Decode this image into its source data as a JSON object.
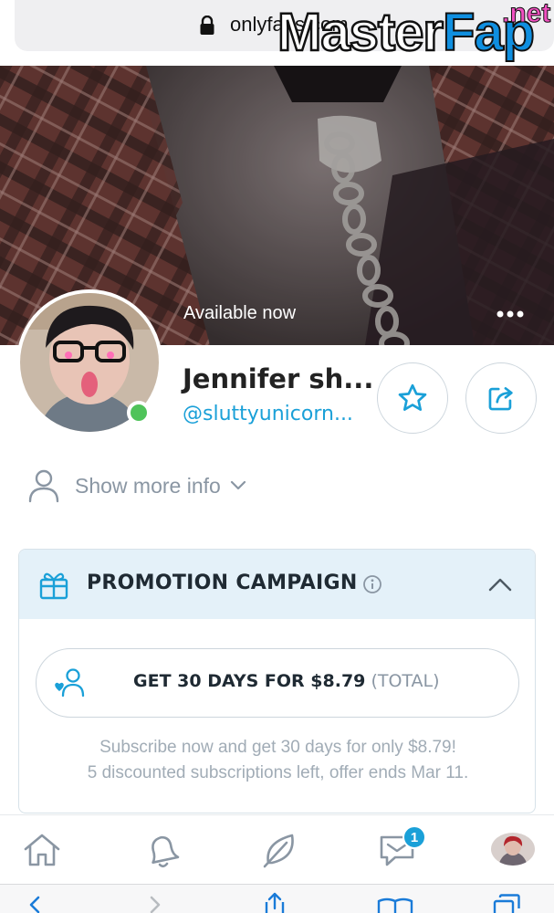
{
  "browser": {
    "url": "onlyfans.com"
  },
  "watermark": {
    "brand_main": "Master",
    "brand_accent": "Fap",
    "brand_tld": ".net"
  },
  "profile": {
    "status": "Available now",
    "name": "Jennifer sh...",
    "handle": "@sluttyunicorn...",
    "online": true,
    "more_info_label": "Show more info"
  },
  "promotion": {
    "title": "PROMOTION CAMPAIGN",
    "offer_main": "GET 30 DAYS FOR $8.79",
    "offer_suffix": "(TOTAL)",
    "description_line1": "Subscribe now and get 30 days for only $8.79!",
    "description_line2": "5 discounted subscriptions left, offer ends Mar 11."
  },
  "tabbar": {
    "message_badge": "1",
    "icons": [
      "home-icon",
      "bell-icon",
      "leaf-icon",
      "message-icon",
      "profile-avatar"
    ]
  },
  "colors": {
    "accent": "#1aa0d8",
    "online": "#4fc35a",
    "promo_header_bg": "#e4f1f9",
    "muted_text": "#8a96a3"
  }
}
